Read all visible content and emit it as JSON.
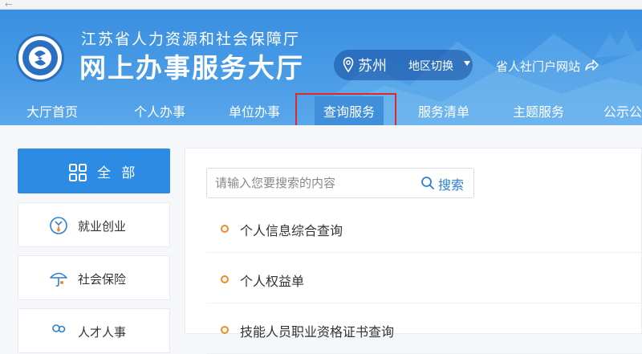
{
  "header": {
    "org_name": "江苏省人力资源和社会保障厅",
    "hall_name": "网上办事服务大厅",
    "city": "苏州",
    "region_switch": "地区切换",
    "portal_link": "省人社门户网站"
  },
  "nav": {
    "items": [
      {
        "label": "大厅首页"
      },
      {
        "label": "个人办事"
      },
      {
        "label": "单位办事"
      },
      {
        "label": "查询服务"
      },
      {
        "label": "服务清单"
      },
      {
        "label": "主题服务"
      },
      {
        "label": "公示公"
      }
    ],
    "active_index": 3
  },
  "sidebar": {
    "items": [
      {
        "label": "全 部",
        "icon": "grid-icon",
        "active": true
      },
      {
        "label": "就业创业",
        "icon": "employment-icon",
        "active": false
      },
      {
        "label": "社会保险",
        "icon": "umbrella-icon",
        "active": false
      },
      {
        "label": "人才人事",
        "icon": "people-icon",
        "active": false
      }
    ]
  },
  "search": {
    "placeholder": "请输入您要搜索的内容",
    "button_label": "搜索"
  },
  "query_list": {
    "items": [
      {
        "label": "个人信息综合查询"
      },
      {
        "label": "个人权益单"
      },
      {
        "label": "技能人员职业资格证书查询"
      }
    ]
  },
  "colors": {
    "header_blue": "#4a9ce6",
    "accent_blue": "#2c8ce4",
    "highlight_red": "#e0282a",
    "bullet_orange": "#f08a24"
  }
}
